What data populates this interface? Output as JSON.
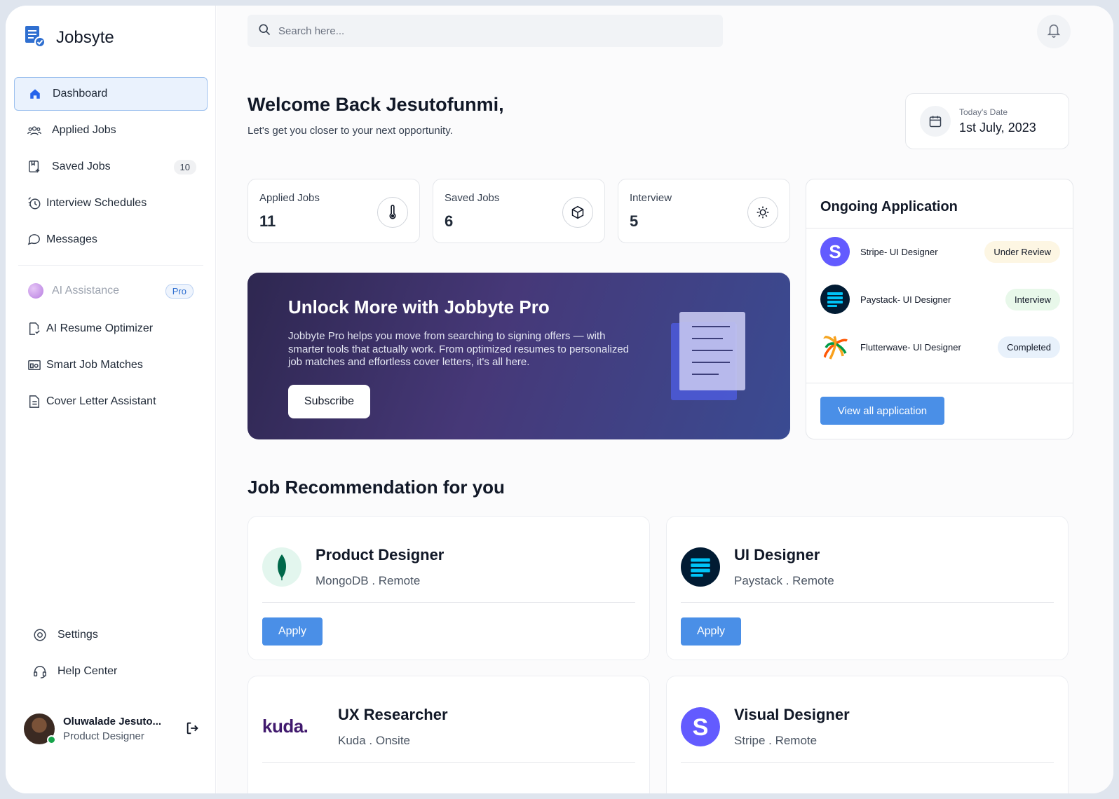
{
  "app": {
    "name": "Jobsyte"
  },
  "sidebar": {
    "items": [
      {
        "label": "Dashboard",
        "icon": "home-icon"
      },
      {
        "label": "Applied Jobs",
        "icon": "users-icon"
      },
      {
        "label": "Saved Jobs",
        "icon": "bookmark-add-icon",
        "badge": "10"
      },
      {
        "label": "Interview Schedules",
        "icon": "clock-schedule-icon"
      },
      {
        "label": "Messages",
        "icon": "chat-bubble-icon"
      }
    ],
    "ai": {
      "label": "AI Assistance",
      "badge": "Pro"
    },
    "ai_items": [
      {
        "label": "AI Resume Optimizer",
        "icon": "resume-check-icon"
      },
      {
        "label": "Smart Job Matches",
        "icon": "match-icon"
      },
      {
        "label": "Cover Letter Assistant",
        "icon": "document-icon"
      }
    ],
    "bottom": [
      {
        "label": "Settings",
        "icon": "gear-icon"
      },
      {
        "label": "Help Center",
        "icon": "headset-icon"
      }
    ],
    "user": {
      "name": "Oluwalade Jesuto...",
      "role": "Product Designer"
    }
  },
  "search": {
    "placeholder": "Search here..."
  },
  "welcome": {
    "title": "Welcome Back Jesutofunmi,",
    "subtitle": "Let's get you closer to your next opportunity."
  },
  "date": {
    "label": "Today's Date",
    "value": "1st July, 2023"
  },
  "stats": [
    {
      "label": "Applied Jobs",
      "value": "11",
      "icon": "thermometer-icon"
    },
    {
      "label": "Saved Jobs",
      "value": "6",
      "icon": "cube-icon"
    },
    {
      "label": "Interview",
      "value": "5",
      "icon": "sun-icon"
    }
  ],
  "promo": {
    "title": "Unlock More with Jobbyte Pro",
    "description": "Jobbyte Pro helps you move from searching to signing offers — with smarter tools that actually work. From optimized resumes to personalized job matches and effortless cover letters, it's all here.",
    "button": "Subscribe"
  },
  "ongoing": {
    "title": "Ongoing Application",
    "items": [
      {
        "name": "Stripe- UI Designer",
        "status": "Under Review"
      },
      {
        "name": "Paystack- UI Designer",
        "status": "Interview"
      },
      {
        "name": "Flutterwave- UI Designer",
        "status": "Completed"
      }
    ],
    "button": "View all application"
  },
  "recommendations": {
    "title": "Job Recommendation for you",
    "jobs": [
      {
        "title": "Product Designer",
        "meta": "MongoDB . Remote",
        "button": "Apply"
      },
      {
        "title": "UI Designer",
        "meta": "Paystack . Remote",
        "button": "Apply"
      },
      {
        "title": "UX Researcher",
        "meta": "Kuda . Onsite",
        "logo_text": "kuda."
      },
      {
        "title": "Visual Designer",
        "meta": "Stripe . Remote"
      }
    ]
  },
  "colors": {
    "accent": "#4a8fe7",
    "active_nav_bg": "#eaf2fd",
    "stripe": "#635bff",
    "paystack": "#011b33",
    "mongodb": "#00684a",
    "kuda": "#40196d"
  }
}
